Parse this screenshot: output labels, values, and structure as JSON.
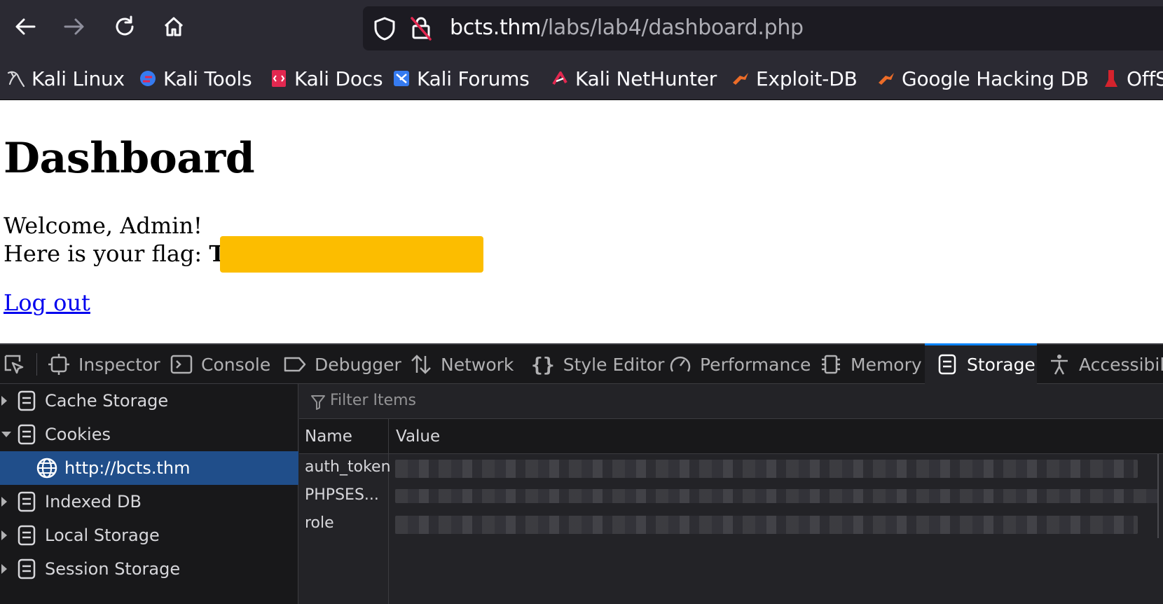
{
  "browser": {
    "url_host": "bcts.thm",
    "url_path": "/labs/lab4/dashboard.php",
    "nav": {
      "back": "back-arrow-icon",
      "forward": "forward-arrow-icon",
      "reload": "reload-icon",
      "home": "home-icon"
    },
    "bookmarks": [
      {
        "label": "Kali Linux",
        "icon": "kali-dragon-icon"
      },
      {
        "label": "Kali Tools",
        "icon": "kali-tools-icon"
      },
      {
        "label": "Kali Docs",
        "icon": "kali-docs-icon"
      },
      {
        "label": "Kali Forums",
        "icon": "kali-forums-icon"
      },
      {
        "label": "Kali NetHunter",
        "icon": "nethunter-icon"
      },
      {
        "label": "Exploit-DB",
        "icon": "exploit-db-icon"
      },
      {
        "label": "Google Hacking DB",
        "icon": "ghdb-icon"
      },
      {
        "label": "OffS",
        "icon": "offsec-icon"
      }
    ]
  },
  "page": {
    "title": "Dashboard",
    "welcome": "Welcome, Admin!",
    "flag_prefix": "Here is your flag: ",
    "flag_visible": "T",
    "logout": "Log out"
  },
  "devtools": {
    "tabs": [
      {
        "label": "Inspector",
        "icon": "inspector-icon"
      },
      {
        "label": "Console",
        "icon": "console-icon"
      },
      {
        "label": "Debugger",
        "icon": "debugger-icon"
      },
      {
        "label": "Network",
        "icon": "network-icon"
      },
      {
        "label": "Style Editor",
        "icon": "style-editor-icon"
      },
      {
        "label": "Performance",
        "icon": "performance-icon"
      },
      {
        "label": "Memory",
        "icon": "memory-icon"
      },
      {
        "label": "Storage",
        "icon": "storage-icon",
        "active": true
      },
      {
        "label": "Accessibilit",
        "icon": "accessibility-icon"
      }
    ],
    "sidebar": [
      {
        "label": "Cache Storage",
        "state": "closed"
      },
      {
        "label": "Cookies",
        "state": "open"
      },
      {
        "label": "http://bcts.thm",
        "state": "selected"
      },
      {
        "label": "Indexed DB",
        "state": "closed"
      },
      {
        "label": "Local Storage",
        "state": "closed"
      },
      {
        "label": "Session Storage",
        "state": "closed"
      }
    ],
    "filter_placeholder": "Filter Items",
    "columns": {
      "name": "Name",
      "value": "Value"
    },
    "rows": [
      {
        "name": "auth_token"
      },
      {
        "name": "PHPSES..."
      },
      {
        "name": "role"
      }
    ],
    "colors": {
      "accent": "#0a84ff",
      "selected_bg": "#204e8a",
      "flag_redaction": "#fcbd00"
    }
  }
}
